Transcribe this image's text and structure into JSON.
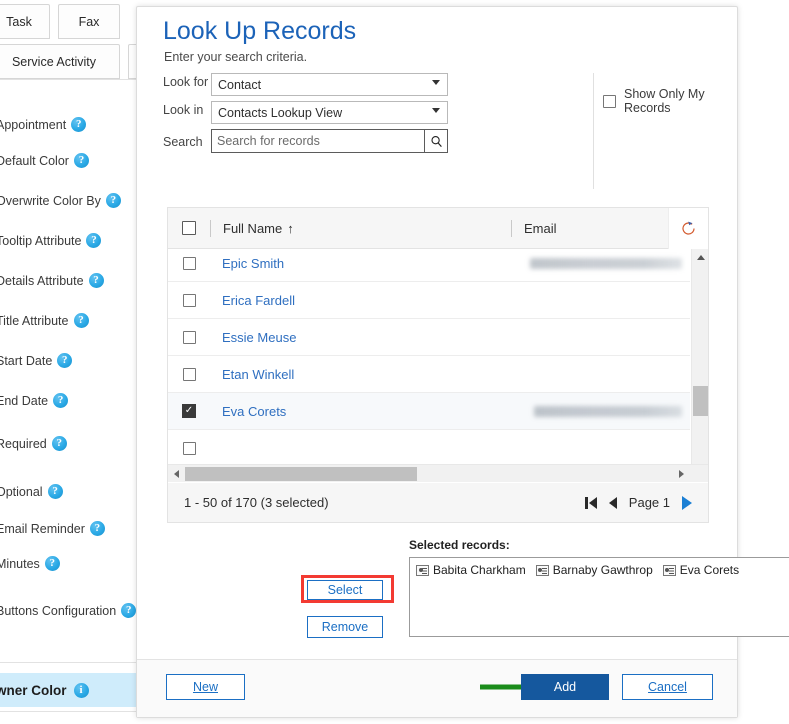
{
  "background_form": {
    "tabs_row1": [
      {
        "label": "Task"
      },
      {
        "label": "Fax"
      }
    ],
    "tabs_row2": [
      {
        "label": "Service Activity"
      }
    ],
    "fields": [
      {
        "label": "Appointment",
        "help": "?"
      },
      {
        "label": "Default Color",
        "help": "?"
      },
      {
        "label": "Overwrite Color By",
        "help": "?"
      },
      {
        "label": "Tooltip Attribute",
        "help": "?"
      },
      {
        "label": "Details Attribute",
        "help": "?"
      },
      {
        "label": "Title Attribute",
        "help": "?"
      },
      {
        "label": "Start Date",
        "help": "?"
      },
      {
        "label": "End Date",
        "help": "?"
      },
      {
        "label": "Required",
        "help": "?"
      },
      {
        "label": "Optional",
        "help": "?"
      },
      {
        "label": "Email Reminder",
        "help": "?"
      },
      {
        "label": "Minutes",
        "help": "?"
      },
      {
        "label": "Buttons Configuration",
        "help": "?"
      }
    ],
    "owner_color": {
      "label": "wner Color",
      "info": "i"
    }
  },
  "dialog": {
    "title": "Look Up Records",
    "subtitle": "Enter your search criteria.",
    "criteria": {
      "look_for_label": "Look for",
      "look_for_value": "Contact",
      "look_in_label": "Look in",
      "look_in_value": "Contacts Lookup View",
      "search_label": "Search",
      "search_value": "",
      "search_placeholder": "Search for records",
      "search_icon": "magnifier-icon",
      "show_only_mine_label": "Show Only My Records",
      "show_only_mine_checked": false
    },
    "grid": {
      "select_all_checked": false,
      "columns": [
        {
          "label": "Full Name",
          "sort": "↑"
        },
        {
          "label": "Email",
          "sort": ""
        }
      ],
      "refresh_icon": "refresh-icon",
      "rows": [
        {
          "name": "Epic Smith",
          "checked": false,
          "email_blurred": true,
          "email_w": 152
        },
        {
          "name": "Erica Fardell",
          "checked": false,
          "email_blurred": false,
          "email_w": 0
        },
        {
          "name": "Essie Meuse",
          "checked": false,
          "email_blurred": false,
          "email_w": 0
        },
        {
          "name": "Etan Winkell",
          "checked": false,
          "email_blurred": false,
          "email_w": 0
        },
        {
          "name": "Eva Corets",
          "checked": true,
          "email_blurred": true,
          "email_w": 148
        }
      ]
    },
    "pagination": {
      "count_text": "1 - 50 of 170 (3 selected)",
      "page_label": "Page 1",
      "first_icon": "first-page-icon",
      "prev_icon": "previous-page-icon",
      "next_icon": "next-page-icon"
    },
    "selected_records": {
      "label": "Selected records:",
      "items": [
        {
          "name": "Babita Charkham"
        },
        {
          "name": "Barnaby Gawthrop"
        },
        {
          "name": "Eva Corets"
        }
      ]
    },
    "side_buttons": {
      "select_label": "Select",
      "remove_label": "Remove",
      "select_highlight_color": "#f33a32"
    },
    "footer": {
      "new_label": "New",
      "add_label": "Add",
      "cancel_label": "Cancel",
      "add_bg": "#15589e",
      "arrow_color": "#1a8c1a",
      "arrow_icon": "green-pointer-arrow-icon"
    }
  }
}
